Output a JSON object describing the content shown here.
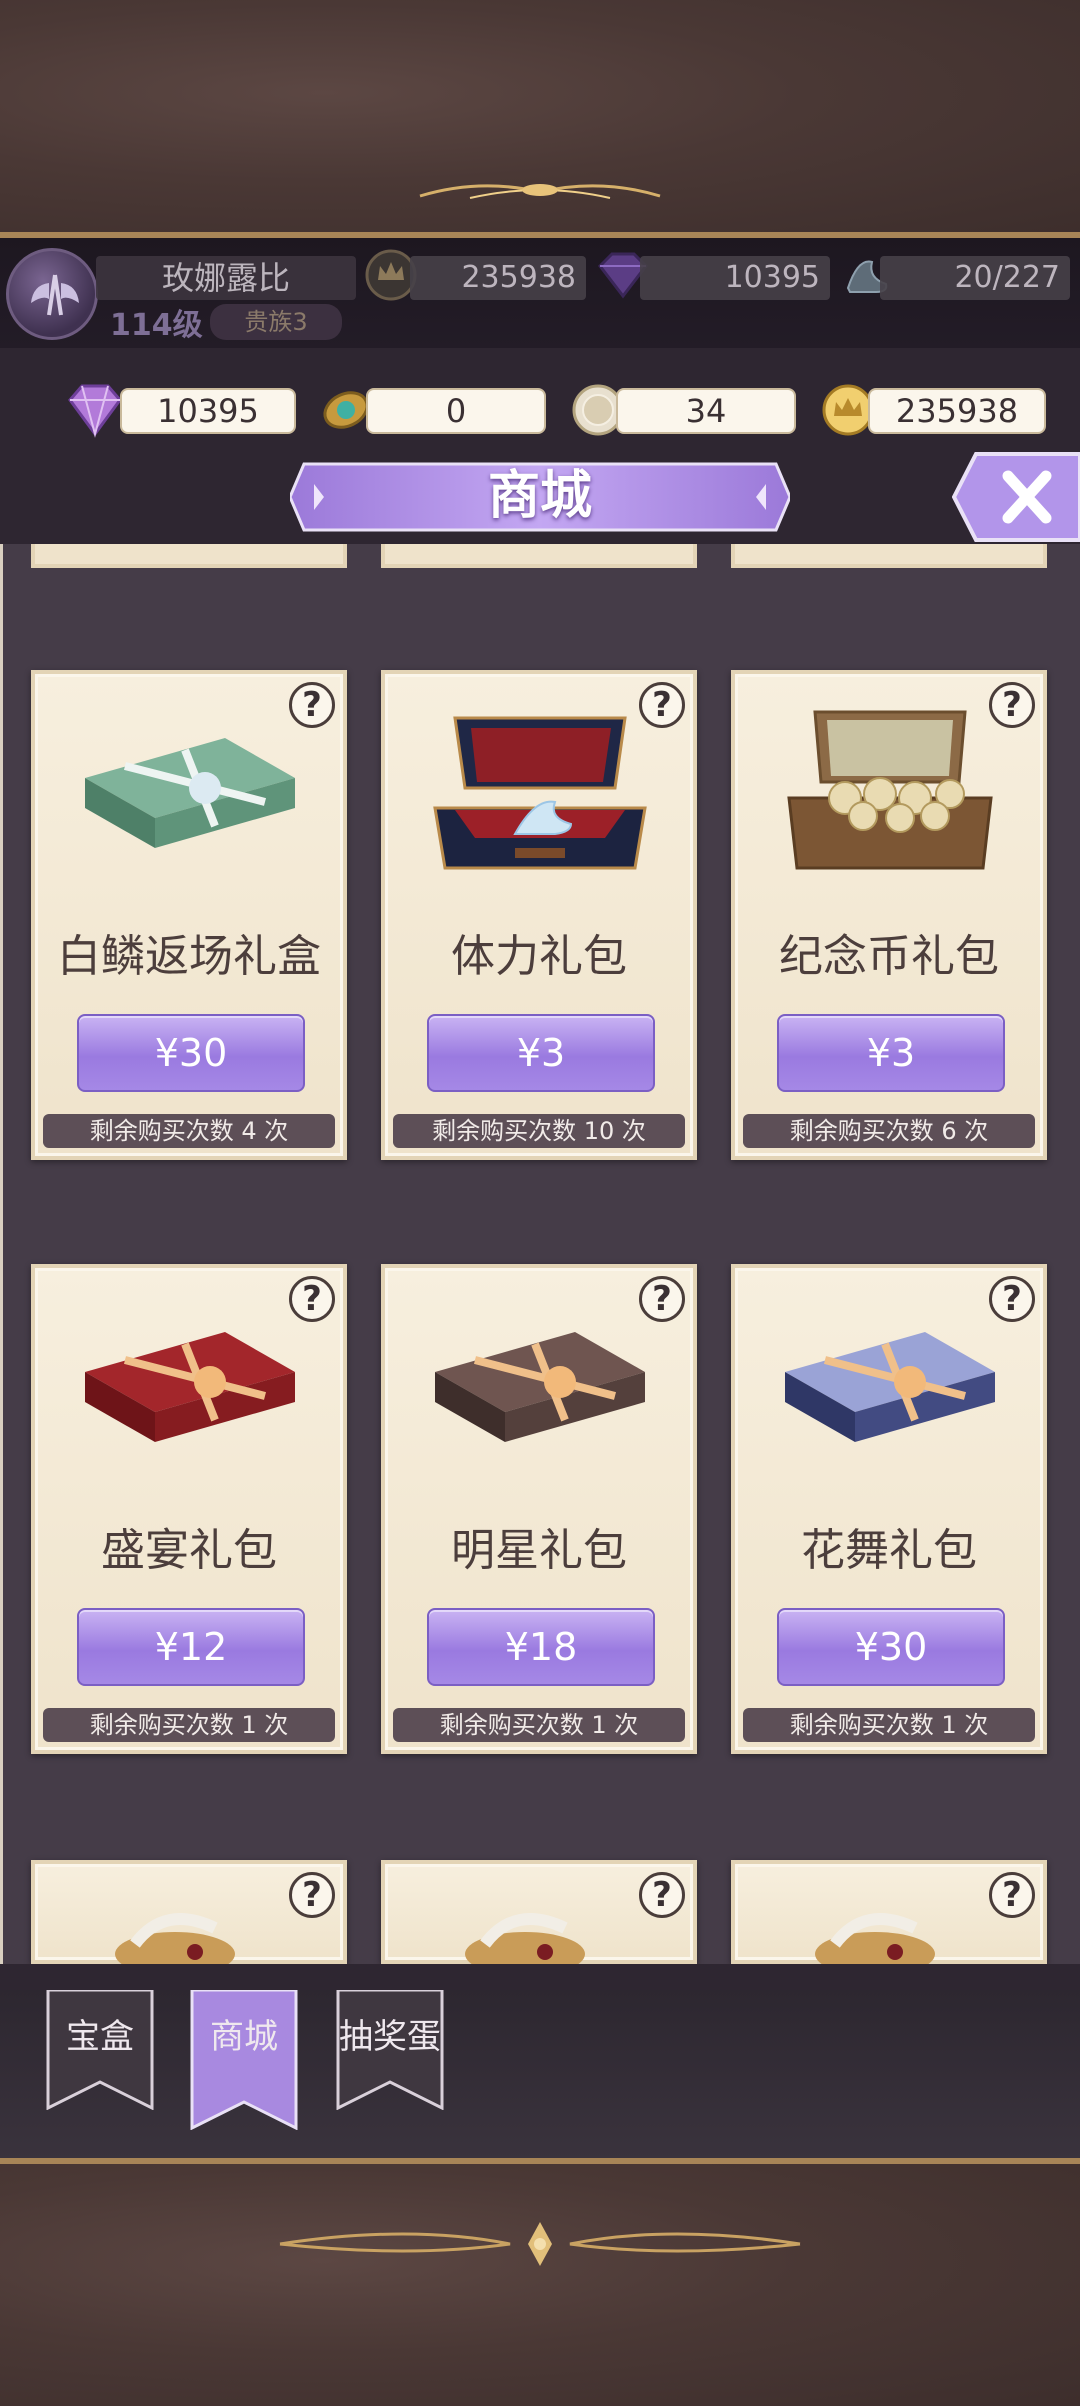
{
  "player": {
    "name": "玫娜露比",
    "level": "114级",
    "rank": "贵族3"
  },
  "top_stats": {
    "gold": "235938",
    "diamond": "10395",
    "stamina": "20/227"
  },
  "currencies": {
    "diamond": "10395",
    "brooch": "0",
    "coin": "34",
    "gold": "235938"
  },
  "title": "商城",
  "close_label": "X",
  "items": [
    {
      "name": "白鳞返场礼盒",
      "price": "¥30",
      "remaining": "剩余购买次数 4 次",
      "icon": "green-gift-box-icon"
    },
    {
      "name": "体力礼包",
      "price": "¥3",
      "remaining": "剩余购买次数 10 次",
      "icon": "glass-slipper-case-icon"
    },
    {
      "name": "纪念币礼包",
      "price": "¥3",
      "remaining": "剩余购买次数 6 次",
      "icon": "coin-suitcase-icon"
    },
    {
      "name": "盛宴礼包",
      "price": "¥12",
      "remaining": "剩余购买次数 1 次",
      "icon": "red-gift-box-icon"
    },
    {
      "name": "明星礼包",
      "price": "¥18",
      "remaining": "剩余购买次数 1 次",
      "icon": "brown-gift-box-icon"
    },
    {
      "name": "花舞礼包",
      "price": "¥30",
      "remaining": "剩余购买次数 1 次",
      "icon": "blue-gift-box-icon"
    }
  ],
  "help_label": "?",
  "tabs": [
    {
      "label": "宝盒",
      "active": false
    },
    {
      "label": "商城",
      "active": true
    },
    {
      "label": "抽奖蛋",
      "active": false
    }
  ],
  "colors": {
    "accent_purple": "#9a7ae0",
    "card_bg": "#f7efde",
    "frame_gold": "#a88557"
  }
}
